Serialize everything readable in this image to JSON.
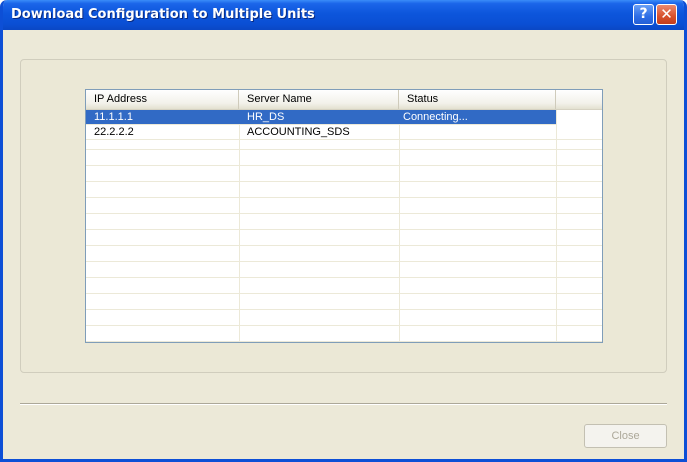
{
  "window": {
    "title": "Download Configuration to Multiple Units",
    "help_glyph": "?",
    "close_glyph": "✕"
  },
  "list": {
    "columns": [
      "IP Address",
      "Server Name",
      "Status"
    ],
    "rows": [
      {
        "ip": "11.1.1.1",
        "server": "HR_DS",
        "status": "Connecting...",
        "selected": true
      },
      {
        "ip": "22.2.2.2",
        "server": "ACCOUNTING_SDS",
        "status": "",
        "selected": false
      }
    ]
  },
  "buttons": {
    "close_label": "Close"
  },
  "colors": {
    "selection": "#316ac5",
    "titlebar": "#0d56dc",
    "face": "#ece9d8"
  }
}
